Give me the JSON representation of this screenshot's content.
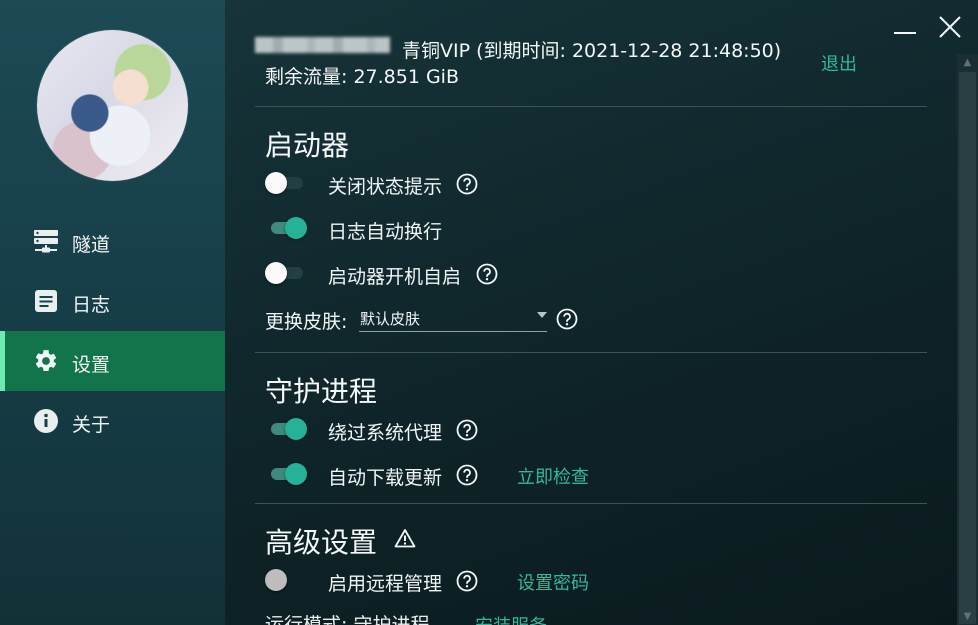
{
  "sidebar": {
    "avatar_alt": "avatar",
    "items": [
      {
        "label": "隧道",
        "icon": "server-icon"
      },
      {
        "label": "日志",
        "icon": "document-icon"
      },
      {
        "label": "设置",
        "icon": "gear-icon"
      },
      {
        "label": "关于",
        "icon": "info-icon"
      }
    ],
    "active_index": 2
  },
  "window": {
    "minimize_icon": "minimize-icon",
    "close_icon": "close-icon"
  },
  "account": {
    "vip_text": "青铜VIP (到期时间: 2021-12-28 21:48:50)",
    "traffic_text": "剩余流量: 27.851 GiB",
    "logout_label": "退出"
  },
  "launcher": {
    "title": "启动器",
    "options": [
      {
        "label": "关闭状态提示",
        "on": false,
        "help": true
      },
      {
        "label": "日志自动换行",
        "on": true,
        "help": false
      },
      {
        "label": "启动器开机自启",
        "on": false,
        "help": true
      }
    ],
    "skin_label": "更换皮肤:",
    "skin_value": "默认皮肤"
  },
  "daemon": {
    "title": "守护进程",
    "options": [
      {
        "label": "绕过系统代理",
        "on": true,
        "help": true
      },
      {
        "label": "自动下载更新",
        "on": true,
        "help": true,
        "link": "立即检查"
      }
    ]
  },
  "advanced": {
    "title": "高级设置",
    "warning_icon": "warning-icon",
    "options": [
      {
        "label": "启用远程管理",
        "on": false,
        "disabled": true,
        "help": true,
        "link": "设置密码"
      }
    ],
    "run_mode_label": "运行模式: 守护进程",
    "install_service_label": "安装服务"
  },
  "colors": {
    "accent": "#34b79b",
    "active_nav": "#12744b",
    "toggle_on": "#26b298"
  }
}
